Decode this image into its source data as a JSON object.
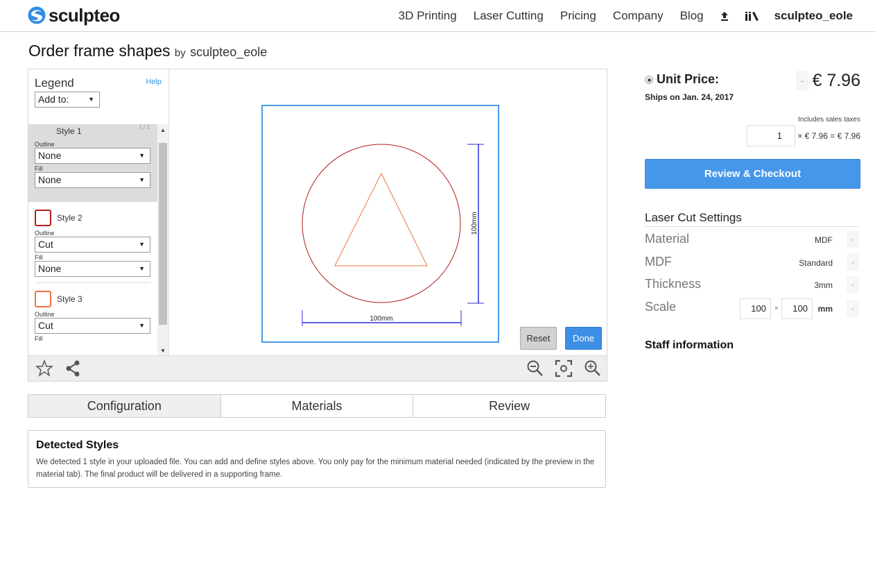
{
  "header": {
    "logo_text": "sculpteo",
    "nav": [
      "3D Printing",
      "Laser Cutting",
      "Pricing",
      "Company",
      "Blog"
    ],
    "icons": [
      "upload-icon",
      "library-icon"
    ],
    "username": "sculpteo_eole"
  },
  "page": {
    "title": "Order frame shapes",
    "by": "by",
    "author": "sculpteo_eole"
  },
  "legend": {
    "title": "Legend",
    "help": "Help",
    "add_to": "Add to:",
    "pager": "1/1",
    "outline_label": "Outline",
    "fill_label": "Fill",
    "styles": [
      {
        "name": "Style 1",
        "outline": "None",
        "fill": "None",
        "color": null
      },
      {
        "name": "Style 2",
        "outline": "Cut",
        "fill": "None",
        "color": "#b01e1e"
      },
      {
        "name": "Style 3",
        "outline": "Cut",
        "fill": "",
        "color": "#f07040"
      }
    ]
  },
  "canvas": {
    "width_label": "100mm",
    "height_label": "100mm",
    "frame_color": "#4a98e8",
    "circle_color": "#b01e1e",
    "triangle_color": "#f07040",
    "dimension_color": "#2b2bd8",
    "reset": "Reset",
    "done": "Done"
  },
  "toolbar": {
    "left_icons": [
      "star-icon",
      "share-icon"
    ],
    "right_icons": [
      "zoom-out-icon",
      "fit-view-icon",
      "zoom-in-icon"
    ]
  },
  "tabs": [
    {
      "label": "Configuration",
      "active": true
    },
    {
      "label": "Materials",
      "active": false
    },
    {
      "label": "Review",
      "active": false
    }
  ],
  "detected": {
    "title": "Detected Styles",
    "text": "We detected 1 style in your uploaded file. You can add and define styles above. You only pay for the minimum material needed (indicated by the preview in the material tab). The final product will be delivered in a supporting frame."
  },
  "pricing": {
    "unit_price_label": "Unit Price:",
    "unit_price": "€ 7.96",
    "ships": "Ships on Jan. 24, 2017",
    "taxes": "Includes sales taxes",
    "quantity": "1",
    "total": "× € 7.96 = € 7.96",
    "checkout": "Review & Checkout"
  },
  "settings": {
    "title": "Laser Cut Settings",
    "rows": [
      {
        "key": "Material",
        "value": "MDF"
      },
      {
        "key": "MDF",
        "value": "Standard"
      },
      {
        "key": "Thickness",
        "value": "3mm"
      }
    ],
    "scale_label": "Scale",
    "scale_x": "100",
    "scale_times": "×",
    "scale_y": "100",
    "scale_unit": "mm"
  },
  "staff": {
    "title": "Staff information"
  }
}
